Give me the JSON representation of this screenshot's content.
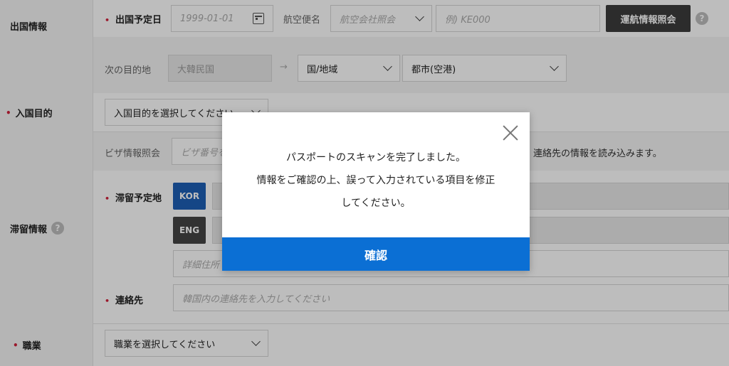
{
  "departure": {
    "section_label": "出国情報",
    "date_label": "出国予定日",
    "date_placeholder": "1999-01-01",
    "flight_label": "航空便名",
    "airline_placeholder": "航空会社照会",
    "flight_placeholder": "例) KE000",
    "lookup_button": "運航情報照会",
    "help": "?",
    "next_dest_label": "次の目的地",
    "next_dest_value": "大韓民国",
    "arrow": "→",
    "country_select": "国/地域",
    "city_select": "都市(空港)"
  },
  "purpose": {
    "section_label": "入国目的",
    "select": "入国目的を選択してください"
  },
  "stay": {
    "section_label": "滞留情報",
    "help": "?",
    "visa_label": "ビザ情報照会",
    "visa_placeholder": "ビザ番号を",
    "visa_note": "、連絡先の情報を読み込みます。",
    "address_label": "滞留予定地",
    "lang_kor": "KOR",
    "lang_eng": "ENG",
    "detail_placeholder": "詳細住所",
    "contact_label": "連絡先",
    "contact_placeholder": "韓国内の連絡先を入力してください"
  },
  "job": {
    "section_label": "職業",
    "select": "職業を選択してください"
  },
  "modal": {
    "line1": "パスポートのスキャンを完了しました。",
    "line2": "情報をご確認の上、誤って入力されている項目を修正",
    "line3": "してください。",
    "confirm": "確認"
  },
  "colors": {
    "primary": "#0b6fd4",
    "required": "#d0213a",
    "dark_button": "#3c3c3c"
  }
}
